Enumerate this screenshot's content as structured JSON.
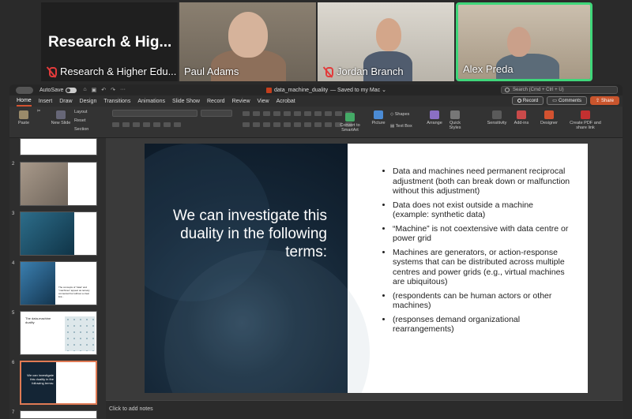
{
  "meeting": {
    "tiles": [
      {
        "name": "Research & Higher Edu...",
        "big_title": "Research & Hig...",
        "muted": true
      },
      {
        "name": "Paul Adams",
        "muted": false
      },
      {
        "name": "Jordan Branch",
        "muted": true
      },
      {
        "name": "Alex Preda",
        "muted": false,
        "active": true
      }
    ]
  },
  "powerpoint": {
    "titlebar": {
      "autosave_label": "AutoSave",
      "doc_title": "data_machine_duality",
      "saved_status": "— Saved to my Mac ⌄",
      "search_placeholder": "Search (Cmd + Ctrl + U)"
    },
    "menu": [
      "Home",
      "Insert",
      "Draw",
      "Design",
      "Transitions",
      "Animations",
      "Slide Show",
      "Record",
      "Review",
      "View",
      "Acrobat"
    ],
    "menu_active": "Home",
    "buttons": {
      "record": "Record",
      "comments": "Comments",
      "share": "Share"
    },
    "ribbon": {
      "paste": "Paste",
      "new_slide": "New Slide",
      "layout": "Layout",
      "reset": "Reset",
      "section": "Section",
      "convert_smartart": "Convert to SmartArt",
      "picture": "Picture",
      "shapes": "Shapes",
      "text_box": "Text Box",
      "arrange": "Arrange",
      "quick_styles": "Quick Styles",
      "sensitivity": "Sensitivity",
      "add_ins": "Add-ins",
      "designer": "Designer",
      "create_pdf": "Create PDF and share link"
    },
    "thumbnails": {
      "numbers": [
        "2",
        "3",
        "4",
        "5",
        "6",
        "7"
      ],
      "slide4_text": "The concepts of \"data\" and \"machines\" appear as tensely connected but without a clear link...",
      "slide5_text": "The data-machine duality",
      "slide6_text": "We can investigate this duality in the following terms:"
    },
    "slide": {
      "heading": "We can investigate this duality in the following terms:",
      "bullets": [
        "Data and machines need permanent reciprocal adjustment (both can break down or malfunction without this adjustment)",
        "Data does not exist outside a machine (example: synthetic data)",
        "“Machine” is not coextensive with data centre or power grid",
        "Machines are generators, or action-response systems that can be distributed across multiple centres and power grids (e.g., virtual machines are ubiquitous)",
        "(respondents can be human actors or other machines)",
        "(responses demand organizational rearrangements)"
      ]
    },
    "notes_placeholder": "Click to add notes"
  },
  "colors": {
    "accent": "#d35230",
    "active_speaker": "#3fd67a",
    "muted": "#e23b3b"
  }
}
